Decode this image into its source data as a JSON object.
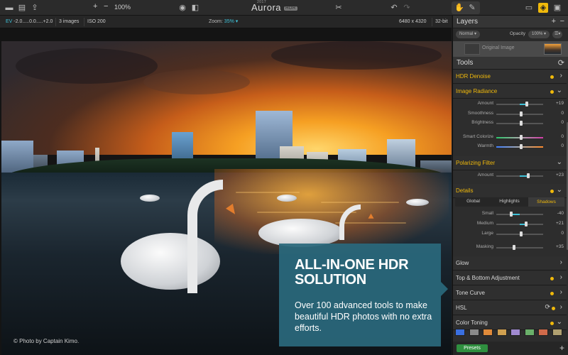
{
  "toolbar": {
    "zoom_in": "+",
    "zoom_out": "−",
    "zoom_level": "100%",
    "app_name": "Aurora",
    "app_badge": "HDR",
    "app_year": "2017"
  },
  "subbar": {
    "ev_label": "EV",
    "ev_values": "-2.0.....0.0.....+2.0",
    "images": "3 images",
    "iso": "ISO 200",
    "zoom_label": "Zoom:",
    "zoom_value": "35% ▾",
    "dimensions": "6480 x 4320",
    "bit_depth": "32-bit"
  },
  "photo": {
    "credit": "© Photo by Captain Kimo."
  },
  "promo": {
    "headline": "ALL-IN-ONE HDR SOLUTION",
    "body": "Over 100 advanced tools to make beautiful HDR photos with no extra efforts."
  },
  "layers": {
    "title": "Layers",
    "blend_mode": "Normal ▾",
    "opacity_label": "Opacity",
    "opacity_value": "100% ▾",
    "layer_name": "Original Image"
  },
  "tools": {
    "title": "Tools",
    "hdr_denoise": "HDR Denoise",
    "image_radiance": {
      "title": "Image Radiance",
      "sliders": [
        {
          "label": "Amount",
          "value": "+19",
          "level": 0.62
        },
        {
          "label": "Smoothness",
          "value": "0",
          "level": 0.5
        },
        {
          "label": "Brightness",
          "value": "0",
          "level": 0.5
        },
        {
          "label": "Smart Colorize",
          "value": "0",
          "level": 0.5
        },
        {
          "label": "Warmth",
          "value": "0",
          "level": 0.5
        }
      ]
    },
    "polarizing_filter": {
      "title": "Polarizing Filter",
      "sliders": [
        {
          "label": "Amount",
          "value": "+23",
          "level": 0.62
        }
      ]
    },
    "details": {
      "title": "Details",
      "tabs": [
        "Global",
        "Highlights",
        "Shadows"
      ],
      "active_tab": "Shadows",
      "sliders": [
        {
          "label": "Small",
          "value": "-40",
          "level": 0.3
        },
        {
          "label": "Medium",
          "value": "+21",
          "level": 0.6
        },
        {
          "label": "Large",
          "value": "0",
          "level": 0.5
        },
        {
          "label": "Masking",
          "value": "+35",
          "level": 0.35
        }
      ]
    },
    "glow": "Glow",
    "top_bottom": "Top & Bottom Adjustment",
    "tone_curve": "Tone Curve",
    "hsl": "HSL",
    "color_toning": "Color Toning"
  },
  "swatch_colors": [
    "#3a6fe0",
    "#8a8a8a",
    "#e08a3a",
    "#d0a050",
    "#a08ad0",
    "#6ab06a",
    "#d06a4a",
    "#b0a070"
  ],
  "presets_label": "Presets",
  "accent_color": "#f0b90b",
  "slider_color": "#3fc1d8"
}
